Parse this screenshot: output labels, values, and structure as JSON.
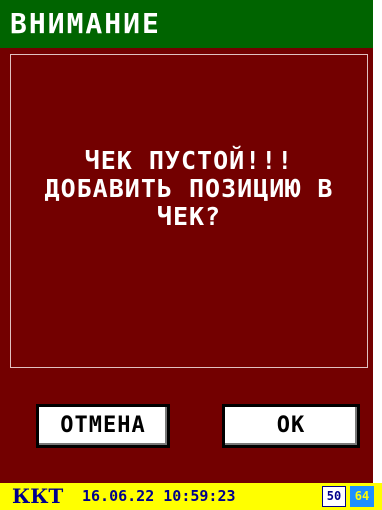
{
  "window": {
    "title": "ВНИМАНИЕ"
  },
  "dialog": {
    "message_lines": [
      "ЧЕК ПУСТОЙ!!!",
      "ДОБАВИТЬ ПОЗИЦИЮ В",
      "ЧЕК?"
    ],
    "buttons": {
      "cancel_label": "ОТМЕНА",
      "ok_label": "ОК"
    }
  },
  "status": {
    "device": "ККТ",
    "datetime": "16.06.22 10:59:23",
    "indicator_1": "50",
    "indicator_2": "64"
  },
  "colors": {
    "background": "#730000",
    "titlebar": "#006400",
    "statusbar": "#ffff00",
    "status_text": "#00008b",
    "indicator_2_bg": "#1e90ff"
  }
}
